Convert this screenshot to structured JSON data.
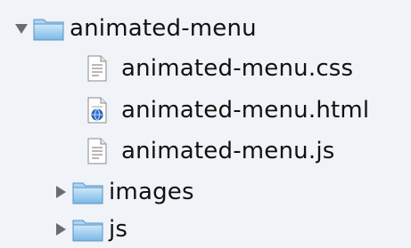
{
  "tree": {
    "root": {
      "label": "animated-menu",
      "expanded": true,
      "icon": "folder-icon",
      "files": [
        {
          "label": "animated-menu.css",
          "icon": "text-document-icon"
        },
        {
          "label": "animated-menu.html",
          "icon": "html-document-icon"
        },
        {
          "label": "animated-menu.js",
          "icon": "text-document-icon"
        }
      ],
      "folders": [
        {
          "label": "images",
          "expanded": false,
          "icon": "folder-icon"
        },
        {
          "label": "js",
          "expanded": false,
          "icon": "folder-icon"
        }
      ]
    }
  },
  "colors": {
    "background": "#f0f3f7",
    "folder": "#8fc6ec",
    "disclosure": "#6b6b6b"
  }
}
